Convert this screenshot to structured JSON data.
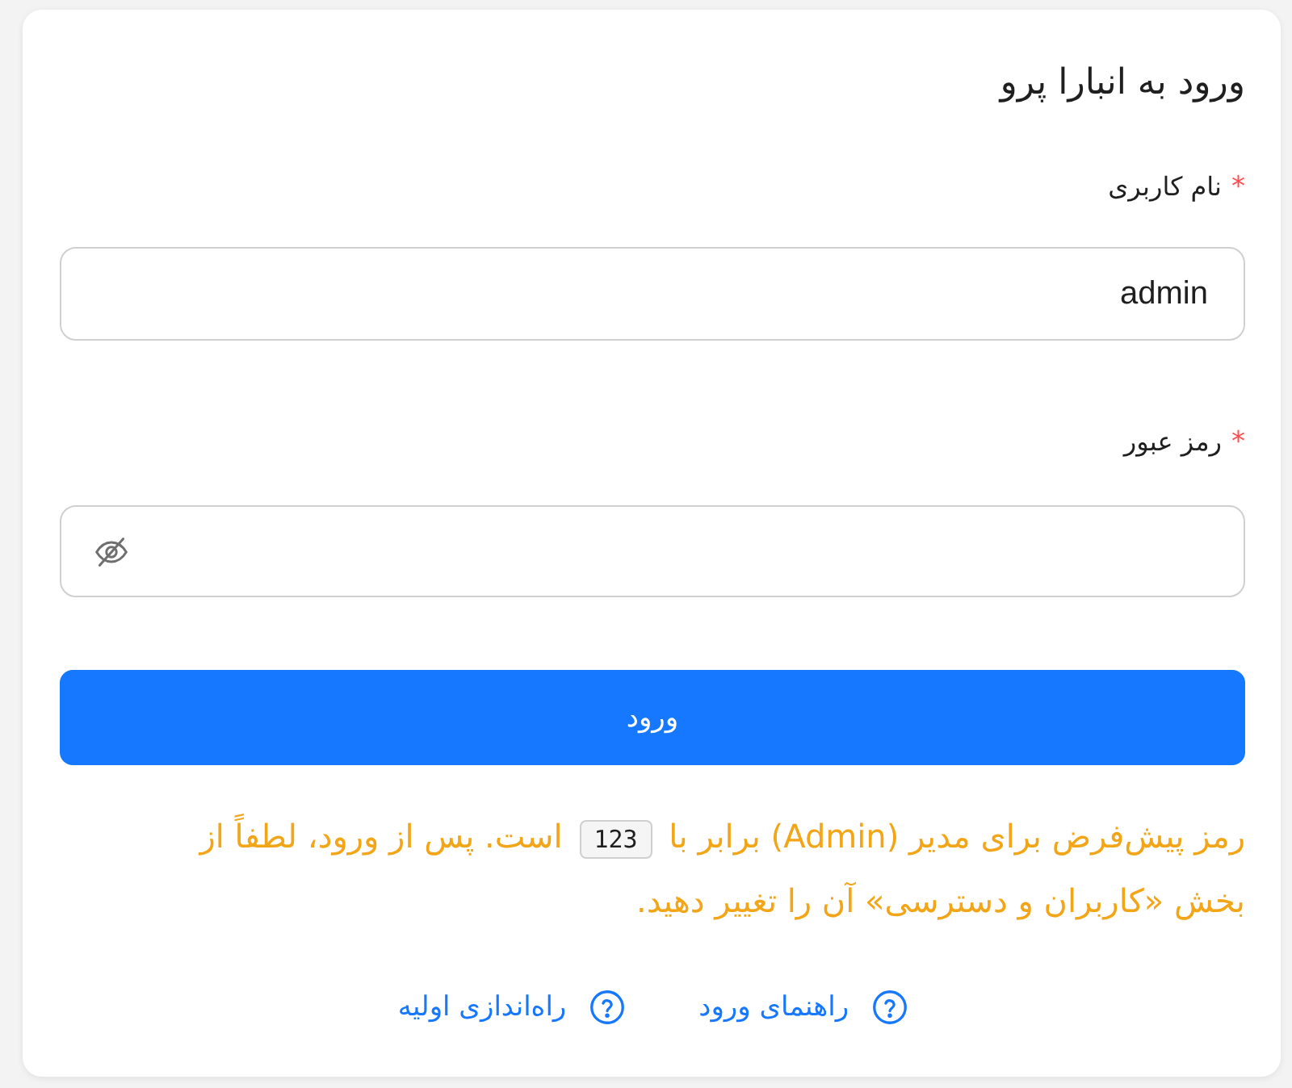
{
  "title": "ورود به انبارا پرو",
  "fields": [
    {
      "kind": "text",
      "label": "نام کاربری",
      "required_mark": "*",
      "value": "admin"
    },
    {
      "kind": "password",
      "label": "رمز عبور",
      "required_mark": "*"
    }
  ],
  "submit_button": {
    "label": "ورود"
  },
  "note": {
    "text_before": "رمز پیش‌فرض برای مدیر (Admin) برابر با",
    "code": "123",
    "text_after": "است. پس از ورود، لطفاً از بخش «کاربران و دسترسی» آن را تغییر دهید."
  },
  "links": [
    {
      "label": "راهنمای ورود"
    },
    {
      "label": "راه‌اندازی اولیه"
    }
  ]
}
